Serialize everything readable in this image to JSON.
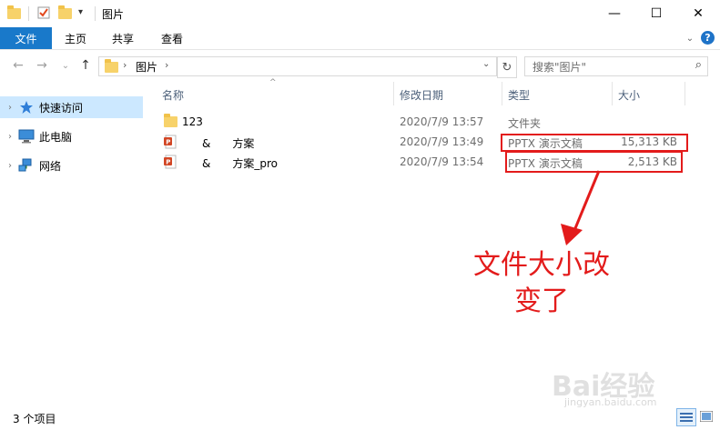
{
  "window": {
    "title": "图片",
    "minimize_glyph": "—",
    "maximize_glyph": "☐",
    "close_glyph": "✕"
  },
  "quick_access_dropdown_glyph": "▾",
  "ribbon": {
    "file_tab": "文件",
    "tabs": [
      "主页",
      "共享",
      "查看"
    ],
    "expand_glyph": "⌄",
    "help_glyph": "?"
  },
  "address": {
    "back_glyph": "←",
    "forward_glyph": "→",
    "recent_glyph": "⌄",
    "up_glyph": "↑",
    "separator_glyph": "›",
    "current_folder": "图片",
    "dropdown_glyph": "⌄",
    "refresh_glyph": "↻"
  },
  "search": {
    "placeholder": "搜索\"图片\"",
    "icon_glyph": "⌕"
  },
  "nav": {
    "arrow_glyph": "›",
    "items": [
      {
        "label": "快速访问",
        "icon": "star-icon",
        "selected": true
      },
      {
        "label": "此电脑",
        "icon": "computer-icon",
        "selected": false
      },
      {
        "label": "网络",
        "icon": "network-icon",
        "selected": false
      }
    ]
  },
  "columns": {
    "sort_glyph": "^",
    "name": "名称",
    "date": "修改日期",
    "type": "类型",
    "size": "大小"
  },
  "rows": [
    {
      "name": "123",
      "date": "2020/7/9 13:57",
      "type": "文件夹",
      "size": "",
      "icon": "folder-icon"
    },
    {
      "name": "&　　方案",
      "date": "2020/7/9 13:49",
      "type": "PPTX 演示文稿",
      "size": "15,313 KB",
      "icon": "pptx-file-icon"
    },
    {
      "name": "&　　方案_pro",
      "date": "2020/7/9 13:54",
      "type": "PPTX 演示文稿",
      "size": "2,513 KB",
      "icon": "pptx-file-icon"
    }
  ],
  "annotation": {
    "line1": "文件大小改",
    "line2": "变了"
  },
  "status": {
    "item_count": "3 个项目"
  },
  "watermark": {
    "main": "Bai经验",
    "sub": "jingyan.baidu.com"
  },
  "colors": {
    "accent": "#1979ca",
    "selection": "#cce8ff",
    "annotation_red": "#e31b1b",
    "folder": "#f7d26a",
    "pptx": "#d24726"
  }
}
